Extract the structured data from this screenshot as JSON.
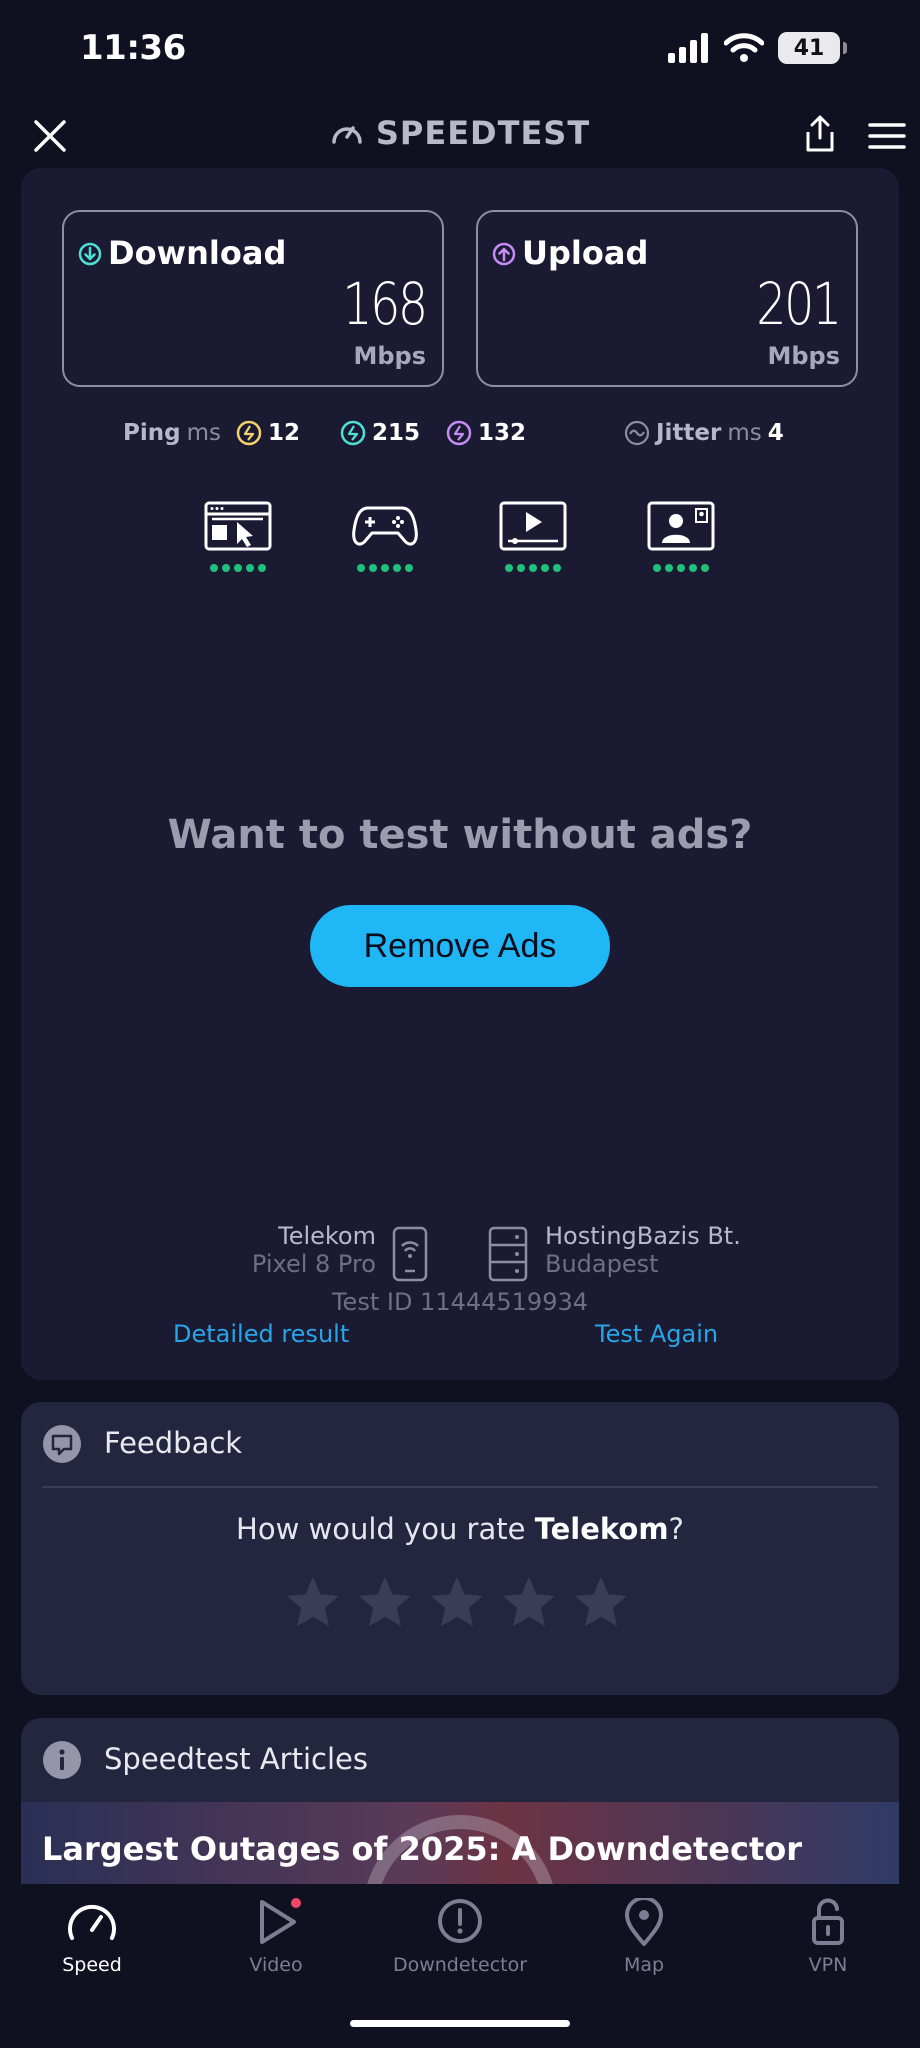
{
  "status_bar": {
    "time": "11:36",
    "battery": "41"
  },
  "header": {
    "title": "SPEEDTEST"
  },
  "results": {
    "download": {
      "label": "Download",
      "value": "168",
      "unit": "Mbps"
    },
    "upload": {
      "label": "Upload",
      "value": "201",
      "unit": "Mbps"
    },
    "ping": {
      "label": "Ping",
      "unit": "ms",
      "idle": "12",
      "download": "215",
      "upload": "132"
    },
    "jitter": {
      "label": "Jitter",
      "unit": "ms",
      "value": "4"
    },
    "experience_icons": [
      "web-browsing-icon",
      "gaming-icon",
      "video-streaming-icon",
      "video-call-icon"
    ],
    "experience_rating": 5
  },
  "promo": {
    "text": "Want to test without ads?",
    "button": "Remove Ads"
  },
  "connection": {
    "provider": "Telekom",
    "device": "Pixel 8 Pro",
    "server_name": "HostingBazis Bt.",
    "server_location": "Budapest",
    "test_id": "Test ID 11444519934",
    "detailed_link": "Detailed result",
    "again_link": "Test Again"
  },
  "feedback": {
    "title": "Feedback",
    "question_prefix": "How would you rate ",
    "question_provider": "Telekom",
    "question_suffix": "?",
    "stars": 5
  },
  "articles": {
    "title": "Speedtest Articles",
    "headline": "Largest Outages of 2025: A Downdetector"
  },
  "tabs": [
    {
      "label": "Speed",
      "icon": "speed-gauge-icon",
      "active": true
    },
    {
      "label": "Video",
      "icon": "play-icon",
      "active": false
    },
    {
      "label": "Downdetector",
      "icon": "alert-icon",
      "active": false
    },
    {
      "label": "Map",
      "icon": "map-pin-icon",
      "active": false
    },
    {
      "label": "VPN",
      "icon": "lock-icon",
      "active": false
    }
  ],
  "colors": {
    "accent": "#1fb7f5",
    "download": "#4fe0d5",
    "upload": "#c58cf3",
    "idle_ping": "#f2d36b",
    "rating_dots": "#1ec27c"
  }
}
